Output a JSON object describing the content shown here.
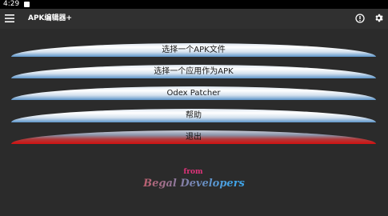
{
  "status_bar": {
    "time": "4:29"
  },
  "app_bar": {
    "title": "APK编辑器+",
    "icons": [
      "menu-icon",
      "info-icon",
      "settings-icon"
    ]
  },
  "buttons": [
    {
      "label": "选择一个APK文件"
    },
    {
      "label": "选择一个应用作为APK"
    },
    {
      "label": "Odex Patcher"
    },
    {
      "label": "帮助"
    },
    {
      "label": "退出"
    }
  ],
  "credit": {
    "from": "from",
    "name": "Begal Developers"
  },
  "colors": {
    "background": "#2b2b2b",
    "button_blue": "#5d95c9",
    "exit_red": "#d11010"
  }
}
